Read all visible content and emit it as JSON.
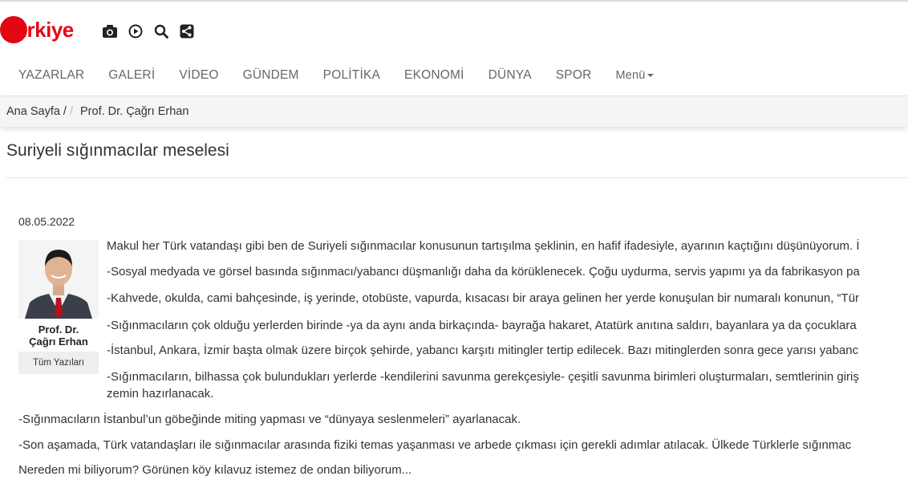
{
  "header": {
    "logo_text": "türkiye",
    "icons": [
      "camera-icon",
      "play-icon",
      "search-icon",
      "share-icon"
    ]
  },
  "nav": {
    "items": [
      "YAZARLAR",
      "GALERİ",
      "VİDEO",
      "GÜNDEM",
      "POLİTİKA",
      "EKONOMİ",
      "DÜNYA",
      "SPOR"
    ],
    "menu_label": "Menü"
  },
  "breadcrumb": {
    "home": "Ana Sayfa /",
    "current": "Prof. Dr. Çağrı Erhan"
  },
  "article": {
    "title": "Suriyeli sığınmacılar meselesi",
    "date": "08.05.2022",
    "author_line1": "Prof. Dr.",
    "author_line2": "Çağrı Erhan",
    "all_posts_label": "Tüm Yazıları",
    "paragraphs": [
      "Makul her Türk vatandaşı gibi ben de Suriyeli sığınmacılar konusunun tartışılma şeklinin, en hafif ifadesiyle, ayarının kaçtığını düşünüyorum. İ",
      "-Sosyal medyada ve görsel basında sığınmacı/yabancı düşmanlığı daha da körüklenecek. Çoğu uydurma, servis yapımı ya da fabrikasyon pa",
      "-Kahvede, okulda, cami bahçesinde, iş yerinde, otobüste, vapurda, kısacası bir araya gelinen her yerde konuşulan bir numaralı konunun, “Tür",
      "-Sığınmacıların çok olduğu yerlerden birinde -ya da aynı anda birkaçında- bayrağa hakaret, Atatürk anıtına saldırı, bayanlara ya da çocuklara",
      "-İstanbul, Ankara, İzmir başta olmak üzere birçok şehirde, yabancı karşıtı mitingler tertip edilecek. Bazı mitinglerden sonra gece yarısı yabanc",
      "-Sığınmacıların, bilhassa çok bulundukları yerlerde -kendilerini savunma gerekçesiyle- çeşitli savunma birimleri oluşturmaları, semtlerinin giriş",
      "zemin hazırlanacak.",
      "-Sığınmacıların İstanbul’un göbeğinde miting yapması ve “dünyaya seslenmeleri” ayarlanacak.",
      "-Son aşamada, Türk vatandaşları ile sığınmacılar arasında fiziki temas yaşanması ve arbede çıkması için gerekli adımlar atılacak. Ülkede Türklerle sığınmac",
      "Nereden mi biliyorum? Görünen köy kılavuz istemez de ondan biliyorum..."
    ]
  },
  "colors": {
    "brand_red": "#e30613",
    "breadcrumb_bg": "#f5f5f5",
    "nav_text": "#666666"
  }
}
